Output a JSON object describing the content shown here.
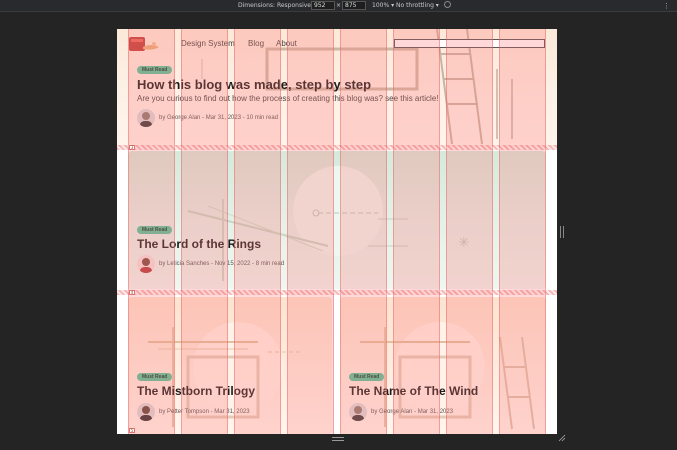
{
  "devtools": {
    "dimensions_label": "Dimensions: Responsive",
    "width_value": "952",
    "times": "×",
    "height_value": "875",
    "zoom": "100%",
    "throttling": "No throttling"
  },
  "header": {
    "nav": [
      {
        "label": "Design System"
      },
      {
        "label": "Blog"
      },
      {
        "label": "About"
      }
    ],
    "search_placeholder": ""
  },
  "posts": [
    {
      "badge": "Must Read",
      "title": "How this blog was made, step by step",
      "excerpt": "Are you curious to find out how the process of creating this blog was? see this article!",
      "byline": "by George Alan - Mar 31, 2023 - 10 min read"
    },
    {
      "badge": "Must Read",
      "title": "The Lord of the Rings",
      "byline": "by Leticia Sanches - Nov 15, 2022 - 8 min read"
    },
    {
      "badge": "Must Read",
      "title": "The Mistborn Trilogy",
      "byline": "by Petter Tompson - Mar 31, 2023"
    },
    {
      "badge": "Must Read",
      "title": "The Name of The Wind",
      "byline": "by George Alan - Mar 31, 2023"
    }
  ],
  "grid_overlay": {
    "row_tags": [
      "3",
      "4",
      "5"
    ]
  },
  "colors": {
    "badge": "#4fc59c",
    "grid_column": "#ff7878",
    "card_orange": "#fbe4d2",
    "card_green": "#d9ede1"
  }
}
